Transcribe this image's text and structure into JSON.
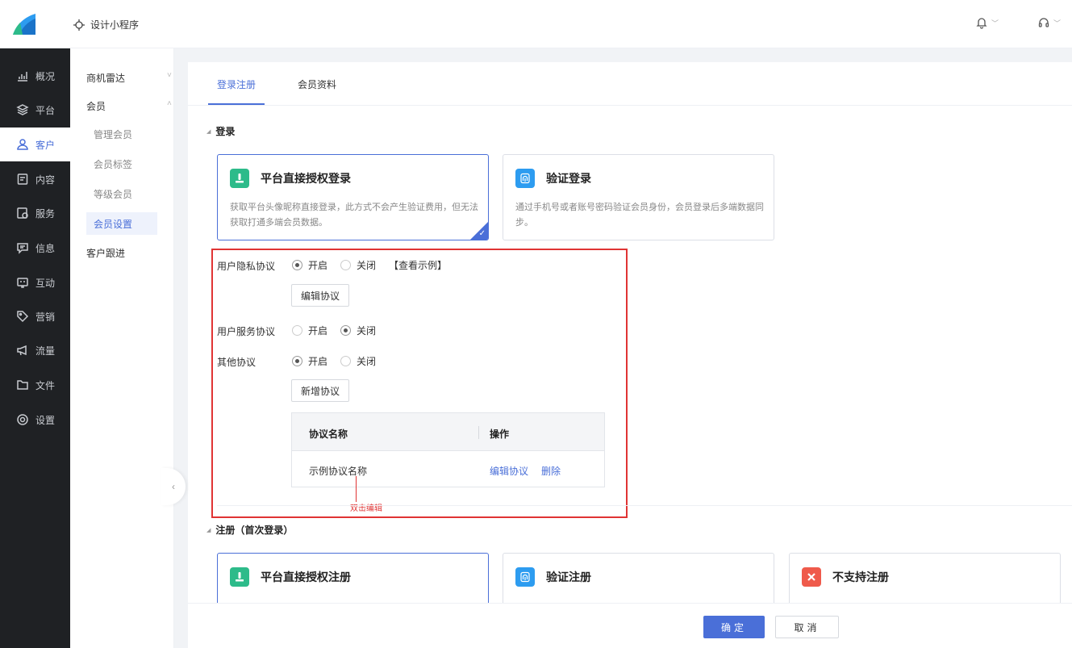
{
  "header": {
    "app_name": "设计小程序",
    "notification_icon": "bell-icon",
    "support_icon": "headset-icon"
  },
  "sidebar": {
    "items": [
      {
        "label": "概况",
        "icon": "chart-icon"
      },
      {
        "label": "平台",
        "icon": "layers-icon"
      },
      {
        "label": "客户",
        "icon": "user-icon",
        "active": true
      },
      {
        "label": "内容",
        "icon": "document-icon"
      },
      {
        "label": "服务",
        "icon": "service-icon"
      },
      {
        "label": "信息",
        "icon": "message-icon"
      },
      {
        "label": "互动",
        "icon": "interact-icon"
      },
      {
        "label": "营销",
        "icon": "tag-icon"
      },
      {
        "label": "流量",
        "icon": "megaphone-icon"
      },
      {
        "label": "文件",
        "icon": "folder-icon"
      },
      {
        "label": "设置",
        "icon": "gear-icon"
      }
    ]
  },
  "subnav": {
    "group1": "商机雷达",
    "group2": "会员",
    "leaves": [
      "管理会员",
      "会员标签",
      "等级会员",
      "会员设置"
    ],
    "group3": "客户跟进"
  },
  "tabs": [
    "登录注册",
    "会员资料"
  ],
  "login_section": {
    "title": "登录",
    "cards": [
      {
        "title": "平台直接授权登录",
        "desc": "获取平台头像昵称直接登录，此方式不会产生验证费用，但无法获取打通多端会员数据。",
        "selected": true
      },
      {
        "title": "验证登录",
        "desc": "通过手机号或者账号密码验证会员身份，会员登录后多端数据同步。",
        "selected": false
      }
    ]
  },
  "agreements": {
    "privacy_label": "用户隐私协议",
    "service_label": "用户服务协议",
    "other_label": "其他协议",
    "on_label": "开启",
    "off_label": "关闭",
    "view_example": "【查看示例】",
    "edit_btn": "编辑协议",
    "add_btn": "新增协议",
    "privacy_on": true,
    "service_on": false,
    "other_on": true,
    "table": {
      "col_name": "协议名称",
      "col_action": "操作",
      "rows": [
        {
          "name": "示例协议名称",
          "edit": "编辑协议",
          "delete": "删除"
        }
      ]
    },
    "annotation": "双击编辑"
  },
  "register_section": {
    "title": "注册（首次登录）",
    "cards": [
      {
        "title": "平台直接授权注册"
      },
      {
        "title": "验证注册"
      },
      {
        "title": "不支持注册"
      }
    ]
  },
  "actions": {
    "confirm": "确定",
    "cancel": "取消"
  },
  "colors": {
    "accent": "#4a6fd8",
    "sidebar_bg": "#1f2124",
    "highlight": "#e03434"
  }
}
